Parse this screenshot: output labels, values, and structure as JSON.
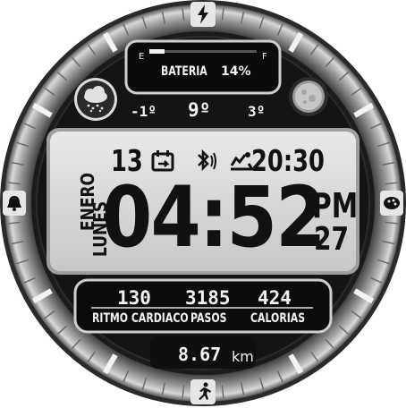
{
  "battery": {
    "empty_label": "E",
    "full_label": "F",
    "label": "BATERIA",
    "percent": "14%",
    "level": 0.14
  },
  "weather": {
    "icon": "cloud-snow-icon",
    "temp_low": "-1º",
    "temp_now": "9º",
    "temp_high": "3º",
    "moon_icon": "moon-icon"
  },
  "status": {
    "day": "13",
    "calendar_icon": "calendar-sync-icon",
    "bluetooth_icon": "bluetooth-vibrate-icon",
    "alarm_icon": "alarm-icon",
    "alarm_time": "20:30"
  },
  "time": {
    "month": "ENERO",
    "weekday": "LUNES",
    "clock": "04:52",
    "ampm": "PM",
    "date": "27"
  },
  "stats": {
    "heart_value": "130",
    "heart_label": "RITMO CARDIACO",
    "steps_value": "3185",
    "steps_label": "PASOS",
    "cal_value": "424",
    "cal_label": "CALORIAS"
  },
  "distance": {
    "value": "8.67",
    "unit": "km"
  },
  "complications": {
    "top": "bolt-icon",
    "left": "bell-icon",
    "right": "palette-icon",
    "bottom": "run-icon"
  },
  "colors": {
    "bezel": "#1a1a1a",
    "panel": "#0d0d0d",
    "lcd": "#dcdcdc",
    "frame": "#bdbdbd",
    "text_light": "#f2f2f2",
    "text_dark": "#111111"
  }
}
